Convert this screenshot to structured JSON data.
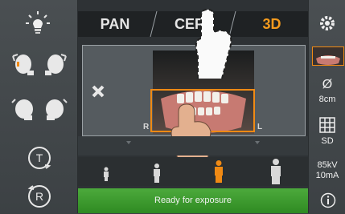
{
  "tabs": {
    "pan": "PAN",
    "ceph": "CEPH",
    "threed": "3D"
  },
  "preview": {
    "left_side": "R",
    "right_side": "L"
  },
  "settings": {
    "diameter": "8cm",
    "resolution": "SD",
    "kv": "85kV",
    "ma": "10mA"
  },
  "status": {
    "text": "Ready for exposure"
  },
  "colors": {
    "accent": "#f39a1e",
    "status_green": "#3a9a2c"
  },
  "icons": {
    "left": [
      "lamp-icon",
      "head-tilt-left-icon",
      "head-tilt-right-icon",
      "head-profile-left-icon",
      "head-profile-right-icon",
      "t-rotate-icon",
      "r-rotate-icon"
    ],
    "right": [
      "settings-gear-icon",
      "thumbnail-icon",
      "diameter-icon",
      "grid-icon",
      "info-icon"
    ]
  },
  "rotate_buttons": {
    "t": "T",
    "r": "R"
  },
  "diameter_symbol": "Ø"
}
